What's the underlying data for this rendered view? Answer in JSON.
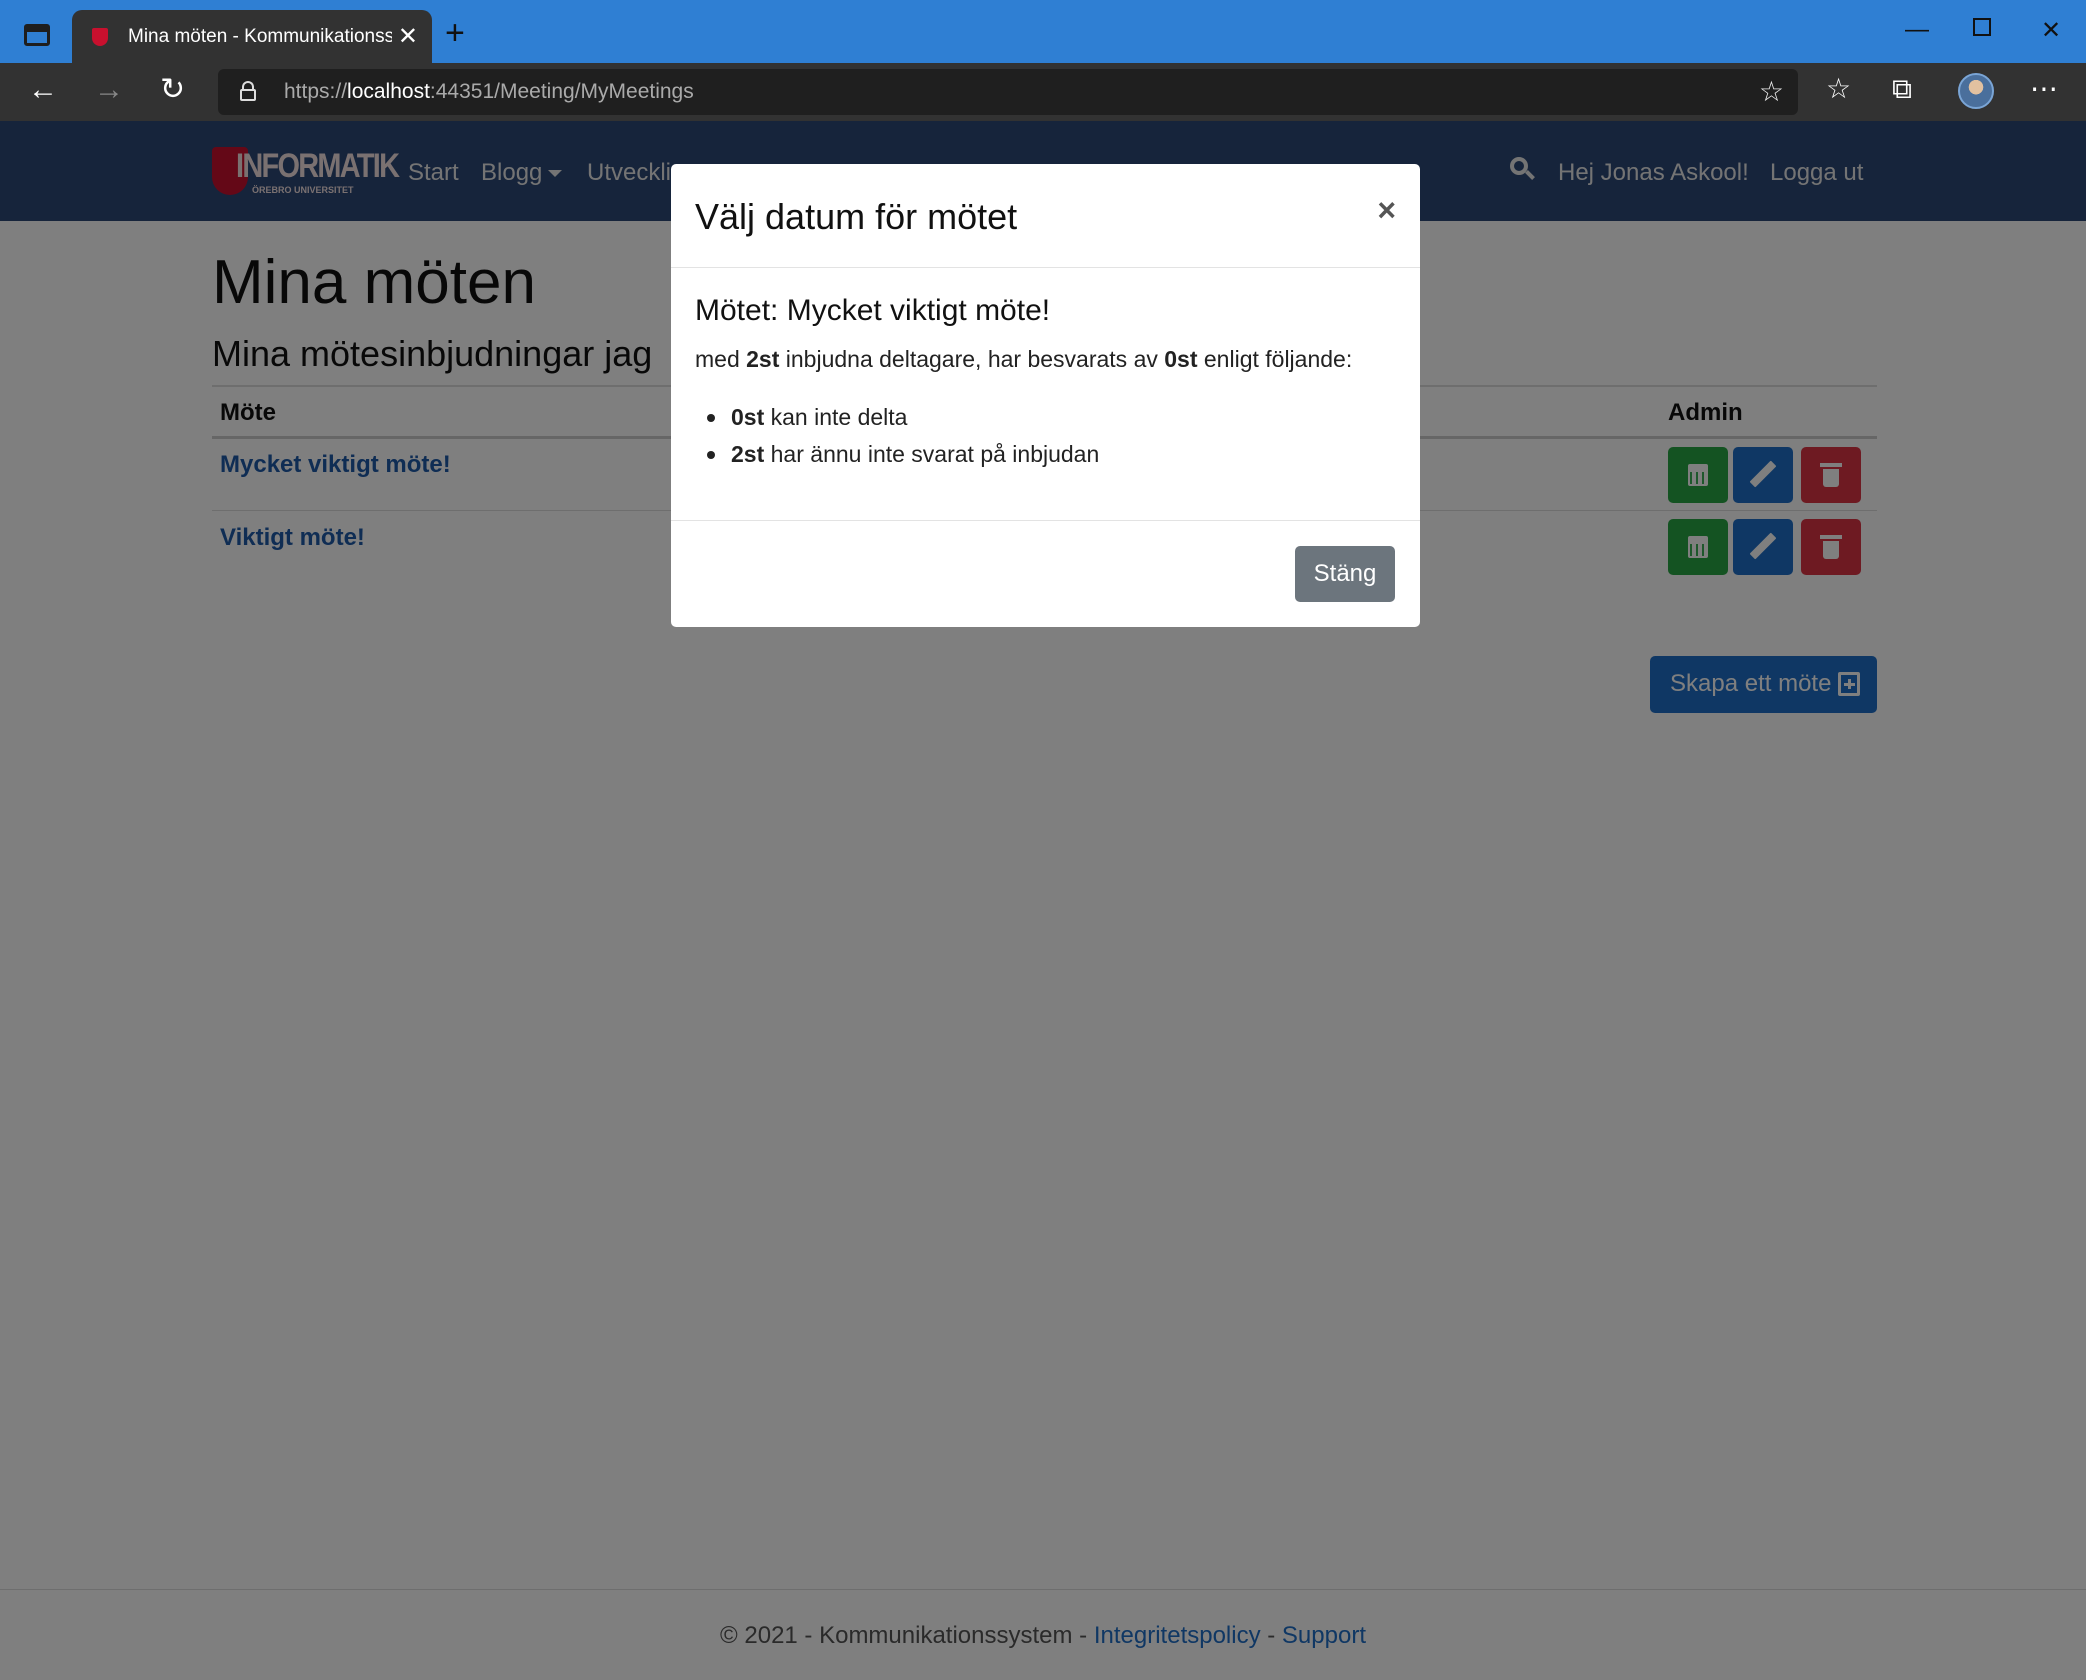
{
  "browser": {
    "tab_title": "Mina möten - Kommunikationssystem",
    "url_prefix": "https://",
    "url_host": "localhost",
    "url_rest": ":44351/Meeting/MyMeetings"
  },
  "navbar": {
    "logo_text": "INFORMATIK",
    "logo_subtext": "ÖREBRO UNIVERSITET",
    "links": [
      "Start",
      "Blogg",
      "Utveckli"
    ],
    "greeting": "Hej Jonas Askool!",
    "logout": "Logga ut"
  },
  "page": {
    "title": "Mina möten",
    "subtitle": "Mina mötesinbjudningar jag",
    "table": {
      "col_meeting": "Möte",
      "col_admin": "Admin",
      "rows": [
        {
          "name": "Mycket viktigt möte!"
        },
        {
          "name": "Viktigt möte!"
        }
      ]
    },
    "create_button": "Skapa ett möte"
  },
  "footer": {
    "text": "© 2021 - Kommunikationssystem - ",
    "privacy": "Integritetspolicy",
    "sep": " - ",
    "support": "Support"
  },
  "modal": {
    "title": "Välj datum för mötet",
    "close_symbol": "×",
    "meeting_line": "Mötet: Mycket viktigt möte!",
    "summary_pre": "med ",
    "invited_count": "2st",
    "summary_mid": " inbjudna deltagare, har besvarats av ",
    "answered_count": "0st",
    "summary_post": " enligt följande:",
    "items": [
      {
        "count": "0st",
        "text": " kan inte delta"
      },
      {
        "count": "2st",
        "text": " har ännu inte svarat på inbjudan"
      }
    ],
    "close_button": "Stäng"
  },
  "colors": {
    "navbar": "#2c4877",
    "primary": "#1e6fc8",
    "success": "#28a745",
    "danger": "#dc3545",
    "secondary": "#6c757d"
  }
}
